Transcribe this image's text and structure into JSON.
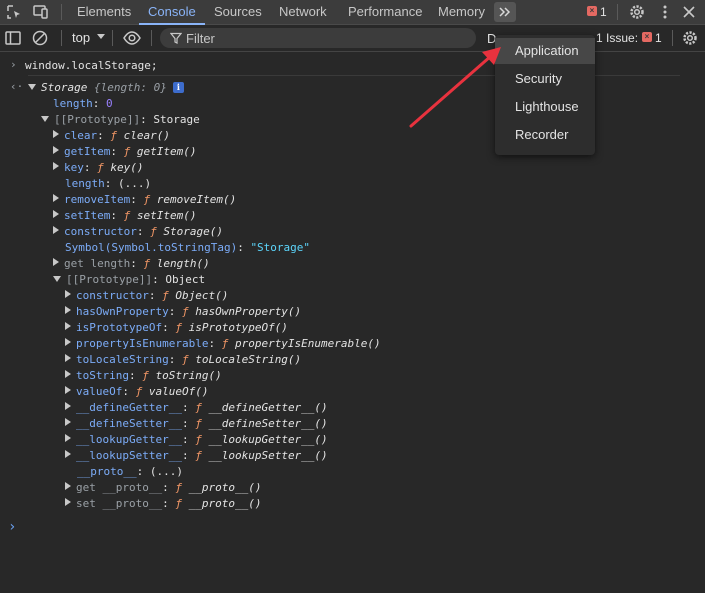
{
  "tabs": [
    "Elements",
    "Console",
    "Sources",
    "Network",
    "Performance",
    "Memory"
  ],
  "active_tab": "Console",
  "more_tabs_icon": "chevron-double-right",
  "error_count": "1",
  "toolbar": {
    "context": "top",
    "filter_placeholder": "Filter",
    "levels_label": "D",
    "issues_label": "1 Issue:",
    "issues_count": "1"
  },
  "console": {
    "command": "window.localStorage;",
    "result_header": "Storage",
    "result_preview": "{length: 0}",
    "info_badge": "i",
    "rows": [
      {
        "key": "length",
        "sep": ": ",
        "val": "0"
      },
      {
        "key": "[[Prototype]]",
        "sep": ": ",
        "val": "Storage"
      },
      {
        "key": "clear",
        "sep": ": ",
        "f": "ƒ",
        "val": "clear()"
      },
      {
        "key": "getItem",
        "sep": ": ",
        "f": "ƒ",
        "val": "getItem()"
      },
      {
        "key": "key",
        "sep": ": ",
        "f": "ƒ",
        "val": "key()"
      },
      {
        "key": "length",
        "sep": ": ",
        "val": "(...)"
      },
      {
        "key": "removeItem",
        "sep": ": ",
        "f": "ƒ",
        "val": "removeItem()"
      },
      {
        "key": "setItem",
        "sep": ": ",
        "f": "ƒ",
        "val": "setItem()"
      },
      {
        "key": "constructor",
        "sep": ": ",
        "f": "ƒ",
        "val": "Storage()"
      },
      {
        "key": "Symbol(Symbol.toStringTag)",
        "sep": ": ",
        "val": "\"Storage\""
      },
      {
        "key": "get length",
        "sep": ": ",
        "f": "ƒ",
        "val": "length()"
      },
      {
        "key": "[[Prototype]]",
        "sep": ": ",
        "val": "Object"
      },
      {
        "key": "constructor",
        "sep": ": ",
        "f": "ƒ",
        "val": "Object()"
      },
      {
        "key": "hasOwnProperty",
        "sep": ": ",
        "f": "ƒ",
        "val": "hasOwnProperty()"
      },
      {
        "key": "isPrototypeOf",
        "sep": ": ",
        "f": "ƒ",
        "val": "isPrototypeOf()"
      },
      {
        "key": "propertyIsEnumerable",
        "sep": ": ",
        "f": "ƒ",
        "val": "propertyIsEnumerable()"
      },
      {
        "key": "toLocaleString",
        "sep": ": ",
        "f": "ƒ",
        "val": "toLocaleString()"
      },
      {
        "key": "toString",
        "sep": ": ",
        "f": "ƒ",
        "val": "toString()"
      },
      {
        "key": "valueOf",
        "sep": ": ",
        "f": "ƒ",
        "val": "valueOf()"
      },
      {
        "key": "__defineGetter__",
        "sep": ": ",
        "f": "ƒ",
        "val": "__defineGetter__()"
      },
      {
        "key": "__defineSetter__",
        "sep": ": ",
        "f": "ƒ",
        "val": "__defineSetter__()"
      },
      {
        "key": "__lookupGetter__",
        "sep": ": ",
        "f": "ƒ",
        "val": "__lookupGetter__()"
      },
      {
        "key": "__lookupSetter__",
        "sep": ": ",
        "f": "ƒ",
        "val": "__lookupSetter__()"
      },
      {
        "key": "__proto__",
        "sep": ": ",
        "val": "(...)"
      },
      {
        "key": "get __proto__",
        "sep": ": ",
        "f": "ƒ",
        "val": "__proto__()"
      },
      {
        "key": "set __proto__",
        "sep": ": ",
        "f": "ƒ",
        "val": "__proto__()"
      }
    ]
  },
  "menu": {
    "items": [
      "Application",
      "Security",
      "Lighthouse",
      "Recorder"
    ],
    "highlighted": "Application"
  },
  "colors": {
    "accent": "#8ab4f8",
    "annotation_arrow": "#e8323e",
    "error_badge": "#e46962"
  }
}
